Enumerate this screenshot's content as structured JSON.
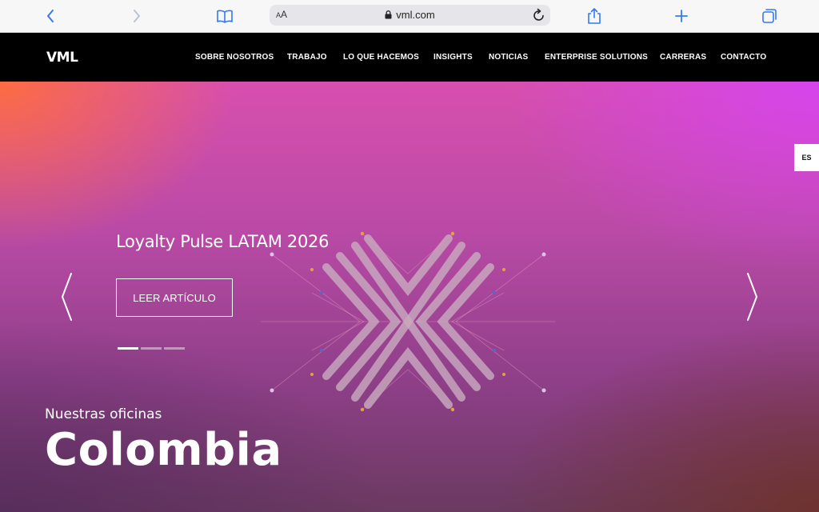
{
  "browser": {
    "text_size_label_small": "A",
    "text_size_label_large": "A",
    "url": "vml.com"
  },
  "site": {
    "logo": "VML",
    "nav": [
      {
        "label": "SOBRE NOSOTROS"
      },
      {
        "label": "TRABAJO"
      },
      {
        "label": "LO QUE HACEMOS"
      },
      {
        "label": "INSIGHTS"
      },
      {
        "label": "NOTICIAS"
      },
      {
        "label": "ENTERPRISE SOLUTIONS"
      },
      {
        "label": "CARRERAS"
      },
      {
        "label": "CONTACTO"
      }
    ]
  },
  "hero": {
    "language": "ES",
    "slide_title": "Loyalty Pulse LATAM 2026",
    "cta_label": "LEER ARTÍCULO",
    "slide_count": 3,
    "active_slide": 1,
    "office_kicker": "Nuestras oficinas",
    "office_name": "Colombia"
  },
  "colors": {
    "browser_icon": "#3478f6",
    "nav_bg": "#000000",
    "hero_orange": "#ff6e3c",
    "hero_magenta": "#d644f0",
    "hero_brown": "#6e3228"
  },
  "icons": {
    "back": "chevron-left-icon",
    "forward": "chevron-right-icon",
    "bookmarks": "book-icon",
    "lock": "lock-icon",
    "reload": "reload-icon",
    "share": "share-icon",
    "new_tab": "plus-icon",
    "tabs": "tabs-icon",
    "prev_slide": "angle-left-icon",
    "next_slide": "angle-right-icon"
  }
}
